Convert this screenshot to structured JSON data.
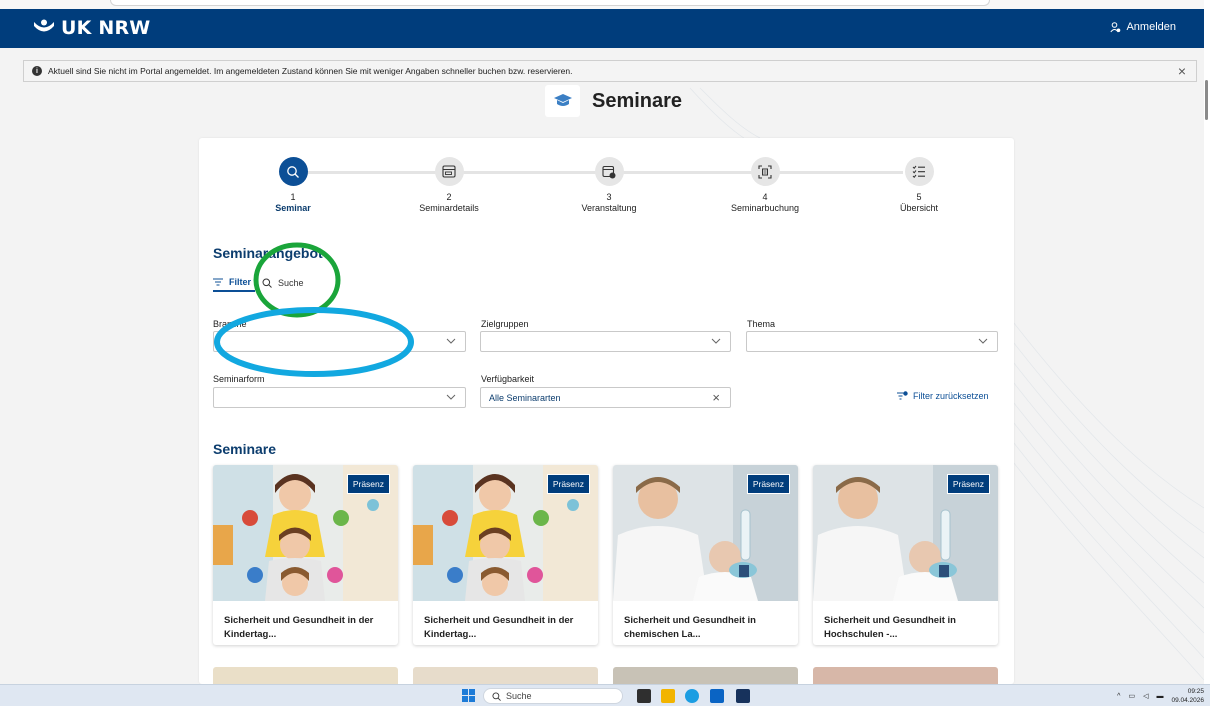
{
  "header": {
    "brand": "UK NRW",
    "login_label": "Anmelden"
  },
  "alert": {
    "text": "Aktuell sind Sie nicht im Portal angemeldet. Im angemeldeten Zustand können Sie mit weniger Angaben schneller buchen bzw. reservieren.",
    "close": "×"
  },
  "page_title": "Seminare",
  "stepper": [
    {
      "num": "1",
      "label": "Seminar",
      "icon": "search-icon",
      "active": true
    },
    {
      "num": "2",
      "label": "Seminardetails",
      "icon": "details-icon"
    },
    {
      "num": "3",
      "label": "Veranstaltung",
      "icon": "calendar-icon"
    },
    {
      "num": "4",
      "label": "Seminarbuchung",
      "icon": "booking-icon"
    },
    {
      "num": "5",
      "label": "Übersicht",
      "icon": "checklist-icon"
    }
  ],
  "offer": {
    "heading": "Seminarangebot",
    "tab_filter": "Filter",
    "tab_search": "Suche"
  },
  "filters": {
    "branche_label": "Branche",
    "zielgruppen_label": "Zielgruppen",
    "thema_label": "Thema",
    "seminarform_label": "Seminarform",
    "verfuegbarkeit_label": "Verfügbarkeit",
    "verfuegbarkeit_value": "Alle Seminararten",
    "reset_label": "Filter zurücksetzen"
  },
  "seminars": {
    "heading": "Seminare",
    "items": [
      {
        "badge": "Präsenz",
        "title": "Sicherheit und Gesundheit in der Kindertag..."
      },
      {
        "badge": "Präsenz",
        "title": "Sicherheit und Gesundheit in der Kindertag..."
      },
      {
        "badge": "Präsenz",
        "title": "Sicherheit und Gesundheit in chemischen La..."
      },
      {
        "badge": "Präsenz",
        "title": "Sicherheit und Gesundheit in Hochschulen -..."
      }
    ]
  },
  "taskbar": {
    "search_label": "Suche",
    "time": "09:25",
    "date": "09.04.2026"
  },
  "colors": {
    "brand_blue": "#003d7c",
    "accent_blue": "#0c4f96",
    "annotation_green": "#1aa53a",
    "annotation_cyan": "#12a8e0"
  }
}
